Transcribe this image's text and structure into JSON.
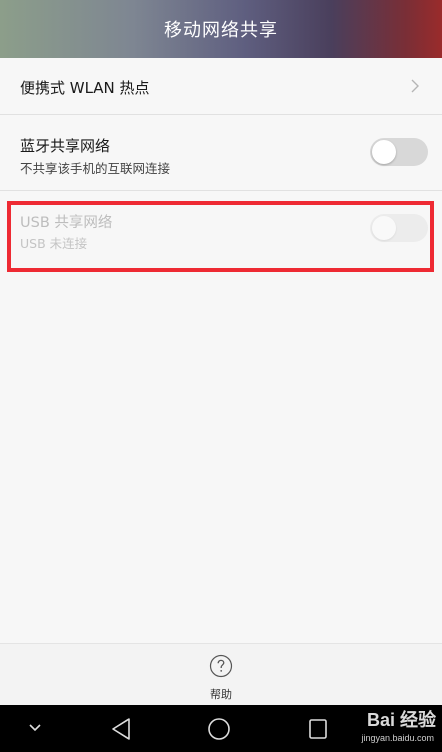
{
  "header": {
    "title": "移动网络共享"
  },
  "rows": {
    "wlan": {
      "label": "便携式 WLAN 热点"
    },
    "bluetooth": {
      "label": "蓝牙共享网络",
      "subtitle": "不共享该手机的互联网连接",
      "enabled": false
    },
    "usb": {
      "label": "USB 共享网络",
      "subtitle": "USB 未连接",
      "enabled": false,
      "disabled": true
    }
  },
  "bottom": {
    "help_label": "帮助"
  },
  "watermark": {
    "brand": "Bai 经验",
    "url": "jingyan.baidu.com"
  },
  "colors": {
    "highlight": "#ee2a33",
    "background": "#f7f7f7"
  }
}
